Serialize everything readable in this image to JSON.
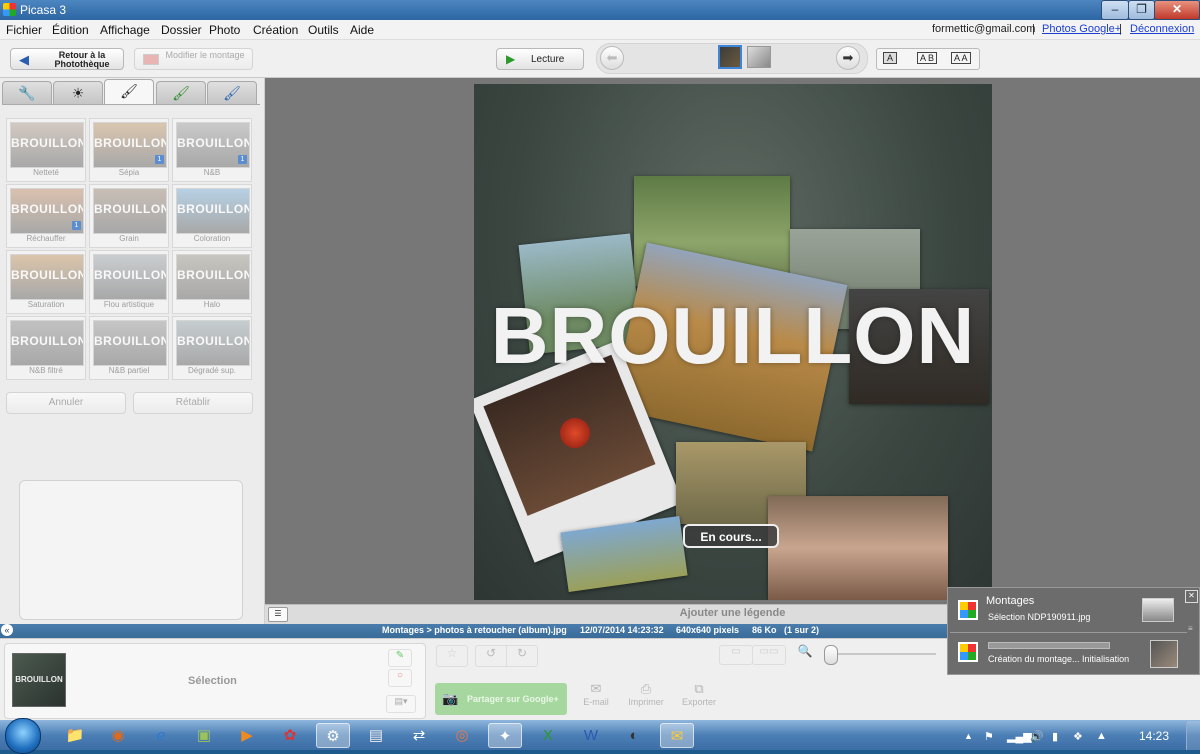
{
  "window": {
    "title": "Picasa 3"
  },
  "menu": {
    "items": [
      "Fichier",
      "Édition",
      "Affichage",
      "Dossier",
      "Photo",
      "Création",
      "Outils",
      "Aide"
    ]
  },
  "account": {
    "email": "formettic@gmail.com",
    "sep1": "|",
    "photos_link": "Photos Google+",
    "sep2": "|",
    "logout": "Déconnexion"
  },
  "toolbar": {
    "back_label": "Retour à la Photothèque",
    "modify_label": "Modifier le montage",
    "play_label": "Lecture",
    "caption_modes": [
      "A",
      "A B",
      "A A"
    ]
  },
  "tabs": [
    {
      "name": "tab-basic-fixes",
      "icon": "wrench-icon",
      "glyph": "🔧"
    },
    {
      "name": "tab-tuning",
      "icon": "sun-icon",
      "glyph": "☀"
    },
    {
      "name": "tab-effects",
      "icon": "brush-icon",
      "glyph": "🖌"
    },
    {
      "name": "tab-effects-2",
      "icon": "brush-green-icon",
      "glyph": "🖌"
    },
    {
      "name": "tab-effects-3",
      "icon": "brush-blue-icon",
      "glyph": "🖌"
    }
  ],
  "effects": [
    {
      "label": "Netteté",
      "thumb": "BROUILLON",
      "badge": ""
    },
    {
      "label": "Sépia",
      "thumb": "BROUILLON",
      "badge": "1"
    },
    {
      "label": "N&B",
      "thumb": "BROUILLON",
      "badge": "1"
    },
    {
      "label": "Réchauffer",
      "thumb": "BROUILLON",
      "badge": "1"
    },
    {
      "label": "Grain",
      "thumb": "BROUILLON",
      "badge": ""
    },
    {
      "label": "Coloration",
      "thumb": "BROUILLON",
      "badge": ""
    },
    {
      "label": "Saturation",
      "thumb": "BROUILLON",
      "badge": ""
    },
    {
      "label": "Flou artistique",
      "thumb": "BROUILLON",
      "badge": ""
    },
    {
      "label": "Halo",
      "thumb": "BROUILLON",
      "badge": ""
    },
    {
      "label": "N&B filtré",
      "thumb": "BROUILLON",
      "badge": ""
    },
    {
      "label": "N&B partiel",
      "thumb": "BROUILLON",
      "badge": ""
    },
    {
      "label": "Dégradé sup.",
      "thumb": "BROUILLON",
      "badge": ""
    }
  ],
  "edit_buttons": {
    "undo": "Annuler",
    "redo": "Rétablir"
  },
  "canvas": {
    "watermark": "BROUILLON",
    "progress": "En cours..."
  },
  "caption": {
    "placeholder": "Ajouter une légende"
  },
  "status": {
    "path": "Montages > photos à retoucher (album).jpg",
    "date": "12/07/2014 14:23:32",
    "dimensions": "640x640 pixels",
    "size": "86 Ko",
    "index": "(1 sur 2)"
  },
  "tray": {
    "selection_label": "Sélection",
    "thumb_text": "BROUILLON",
    "share": "Partager sur Google+",
    "email": "E-mail",
    "print": "Imprimer",
    "export": "Exporter"
  },
  "notification": {
    "title": "Montages",
    "line1": "Sélection NDP190911.jpg",
    "line2": "Création du montage... Initialisation"
  },
  "taskbar": {
    "clock": "14:23"
  },
  "colors": {
    "accent": "#3a6c9a",
    "canvas_bg": "#777777",
    "play_green": "#2a9b2a"
  }
}
